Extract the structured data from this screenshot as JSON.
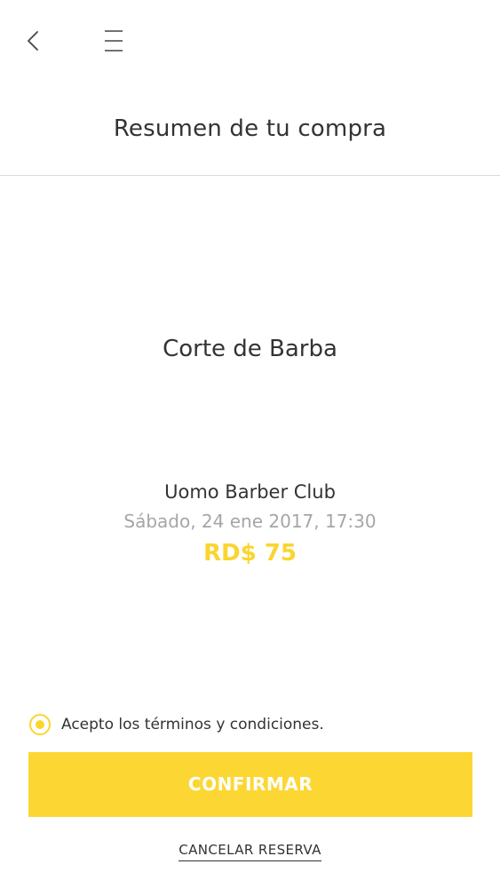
{
  "header": {
    "back_icon": "chevron-left-icon",
    "menu_icon": "hamburger-menu-icon",
    "title": "Resumen de tu compra"
  },
  "summary": {
    "service": "Corte de Barba",
    "venue": "Uomo Barber Club",
    "datetime": "Sábado, 24 ene 2017, 17:30",
    "price": "RD$ 75"
  },
  "terms": {
    "label": "Acepto los términos y condiciones.",
    "checked": true
  },
  "actions": {
    "confirm_label": "CONFIRMAR",
    "cancel_label": "CANCELAR RESERVA"
  },
  "colors": {
    "accent": "#fcd734",
    "text": "#333333",
    "muted": "#a6a6a6",
    "divider": "#d9d9d9"
  }
}
